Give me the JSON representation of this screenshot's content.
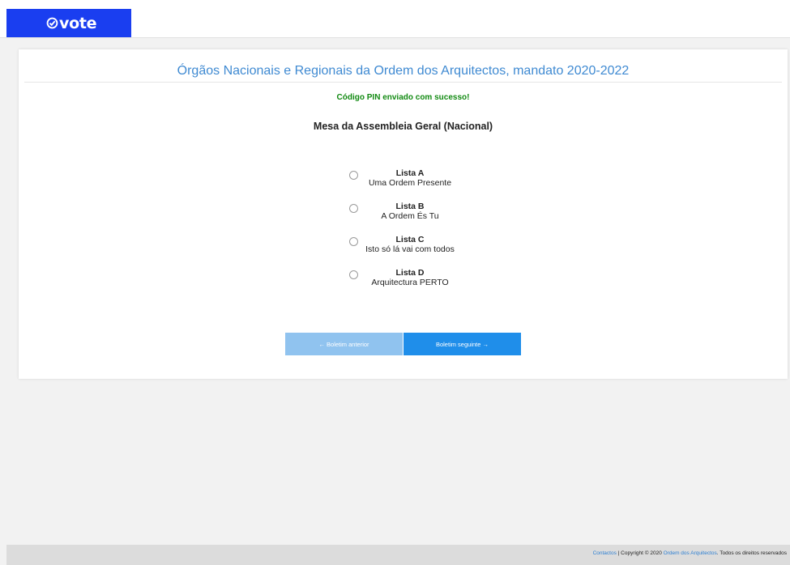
{
  "logo": {
    "text": "vote"
  },
  "election": {
    "title": "Órgãos Nacionais e Regionais da Ordem dos Arquitectos, mandato 2020-2022"
  },
  "status": {
    "message": "Código PIN enviado com sucesso!"
  },
  "ballot": {
    "title": "Mesa da Assembleia Geral (Nacional)",
    "options": [
      {
        "name": "Lista A",
        "description": "Uma Ordem Presente"
      },
      {
        "name": "Lista B",
        "description": "A Ordem És Tu"
      },
      {
        "name": "Lista C",
        "description": "Isto só lá vai com todos"
      },
      {
        "name": "Lista D",
        "description": "Arquitectura PERTO"
      }
    ]
  },
  "navigation": {
    "prev_label": "← Boletim anterior",
    "next_label": "Boletim seguinte →"
  },
  "footer": {
    "contacts_link": "Contactos",
    "copyright_text": " | Copyright © 2020 ",
    "org_link": "Ordem dos Arquitectos",
    "rights_text": ". Todos os direitos reservados"
  },
  "colors": {
    "brand": "#1a3ef0",
    "title": "#3f8ad2",
    "success": "#128a12",
    "button_primary": "#1f8eea",
    "button_disabled": "#90c3ef"
  }
}
